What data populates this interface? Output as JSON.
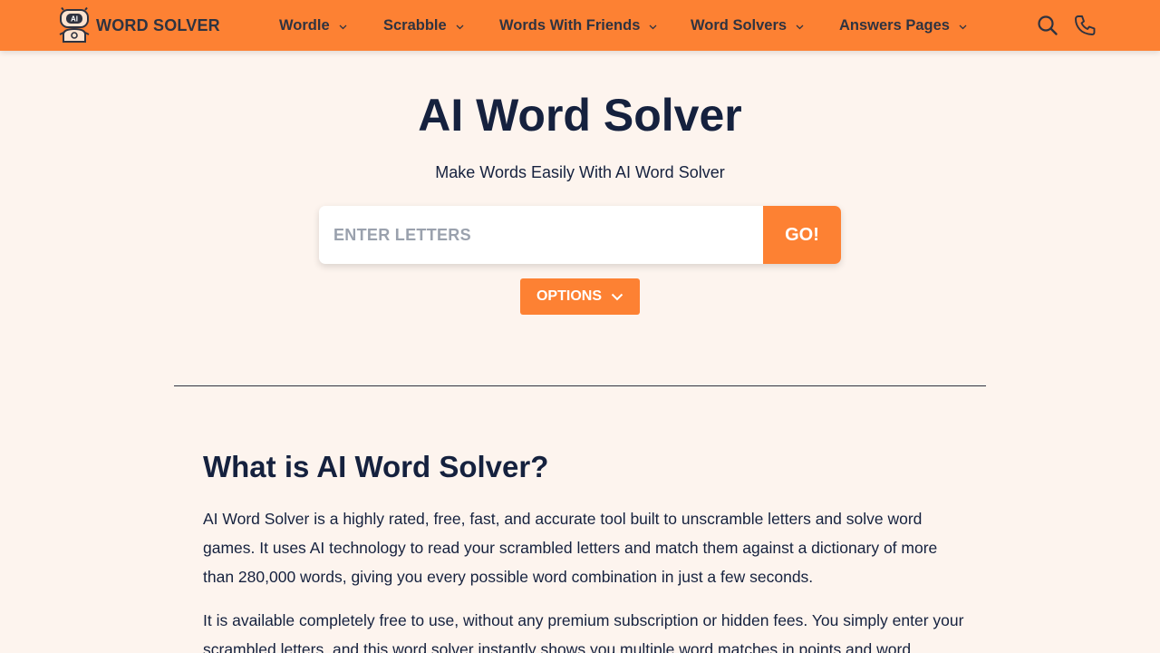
{
  "brand": {
    "name": "WORD SOLVER",
    "logo_badge": "AI",
    "logo_icon": "robot-logo-icon"
  },
  "nav": {
    "items": [
      {
        "label": "Wordle"
      },
      {
        "label": "Scrabble"
      },
      {
        "label": "Words With Friends"
      },
      {
        "label": "Word Solvers"
      },
      {
        "label": "Answers Pages"
      }
    ],
    "icons": [
      "search-icon",
      "phone-icon"
    ]
  },
  "hero": {
    "title": "AI Word Solver",
    "subtitle": "Make Words Easily With AI Word Solver"
  },
  "search": {
    "placeholder": "ENTER LETTERS",
    "value": "",
    "go_label": "GO!",
    "options_label": "OPTIONS"
  },
  "article": {
    "heading": "What is AI Word Solver?",
    "paragraphs": [
      "AI Word Solver is a highly rated, free, fast, and accurate tool built to unscramble letters and solve word games. It uses AI technology to read your scrambled letters and match them against a dictionary of more than 280,000 words, giving you every possible word combination in just a few seconds.",
      "It is available completely free to use, without any premium subscription or hidden fees. You simply enter your scrambled letters, and this word solver instantly shows you multiple word matches in points and word"
    ]
  },
  "colors": {
    "accent": "#fd8133",
    "background": "#fdf4ee",
    "text": "#15213e",
    "nav_text": "#2f3340"
  }
}
